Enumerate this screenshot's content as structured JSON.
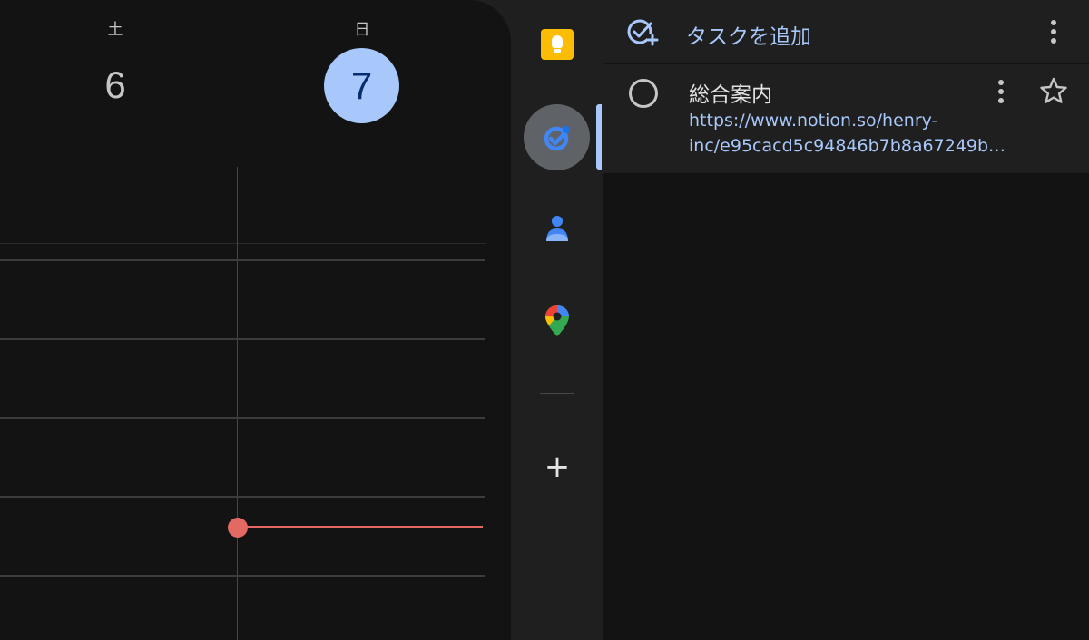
{
  "calendar": {
    "days": [
      {
        "dow": "土",
        "date": "6"
      },
      {
        "dow": "日",
        "date": "7",
        "today": true
      }
    ],
    "now_indicator_color": "#e46962",
    "today_color": "#a8c7fa"
  },
  "rail": {
    "apps": [
      {
        "name": "keep",
        "icon": "keep-icon",
        "color": "#fbbc04"
      },
      {
        "name": "tasks",
        "icon": "tasks-icon",
        "active": true,
        "color": "#4285f4"
      },
      {
        "name": "contacts",
        "icon": "contacts-icon",
        "color": "#4285f4"
      },
      {
        "name": "maps",
        "icon": "maps-icon"
      }
    ],
    "add_icon": "plus-icon"
  },
  "tasks": {
    "add_task_label": "タスクを追加",
    "items": [
      {
        "title": "総合案内",
        "link_line1": "https://www.notion.so/henry-",
        "link_line2": "inc/e95cacd5c94846b7b8a67249b…",
        "starred": false
      }
    ]
  }
}
